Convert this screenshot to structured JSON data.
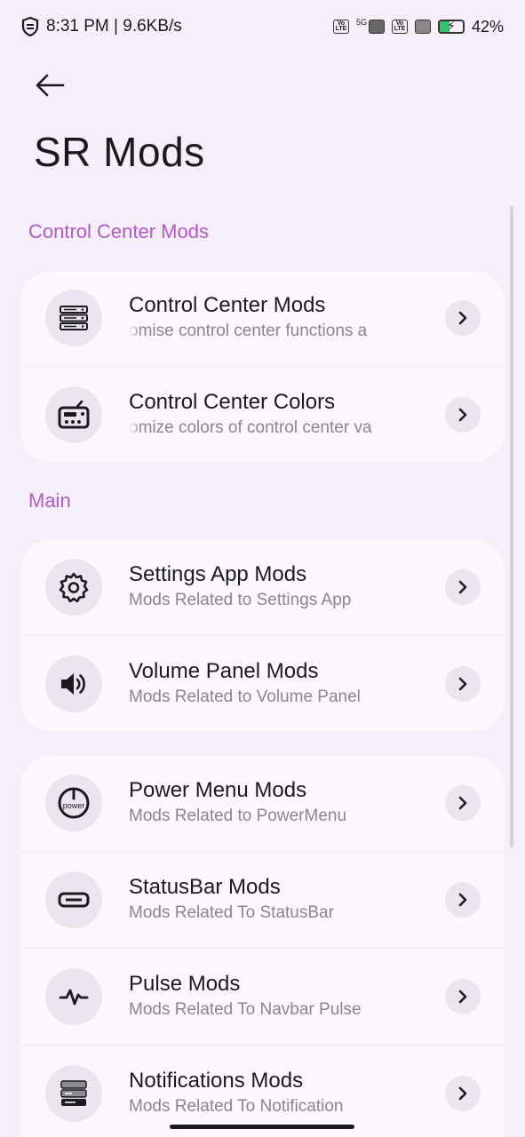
{
  "status_bar": {
    "time_speed": "8:31 PM | 9.6KB/s",
    "volte_label": "Vo LTE",
    "network_5g": "5G",
    "battery_percent": "42%",
    "battery_level": 0.42
  },
  "header": {
    "title": "SR Mods"
  },
  "sections": {
    "control_center": {
      "label": "Control Center Mods",
      "items": [
        {
          "title": "Control Center Mods",
          "subtitle": "omise control center functions a",
          "icon": "server-rack-icon"
        },
        {
          "title": "Control Center Colors",
          "subtitle": "omize colors of control center va",
          "icon": "radio-icon"
        }
      ]
    },
    "main": {
      "label": "Main",
      "group1": [
        {
          "title": "Settings App Mods",
          "subtitle": "Mods Related to Settings App",
          "icon": "gear-icon"
        },
        {
          "title": "Volume Panel Mods",
          "subtitle": "Mods Related to Volume Panel",
          "icon": "speaker-icon"
        }
      ],
      "group2": [
        {
          "title": "Power Menu Mods",
          "subtitle": "Mods Related to PowerMenu",
          "icon": "power-icon",
          "icon_text": "power"
        },
        {
          "title": "StatusBar Mods",
          "subtitle": "Mods Related To StatusBar",
          "icon": "statusbar-icon"
        },
        {
          "title": "Pulse Mods",
          "subtitle": "Mods Related To Navbar Pulse",
          "icon": "pulse-icon"
        },
        {
          "title": "Notifications Mods",
          "subtitle": "Mods Related To Notification",
          "icon": "notification-icon"
        }
      ]
    }
  },
  "colors": {
    "background": "#f6eef8",
    "card": "#fcf7fd",
    "accent": "#b45ac8",
    "icon_bg": "#ece4ef"
  }
}
